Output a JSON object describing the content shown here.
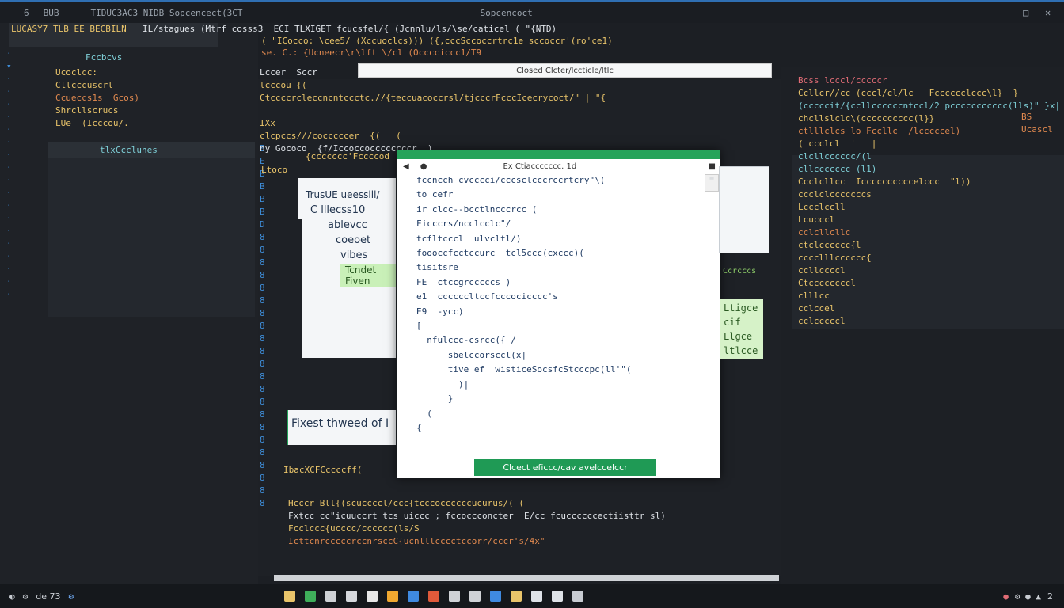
{
  "titlebar": {
    "left_a": "6",
    "left_b": "BUB",
    "path": "TIDUC3AC3 NIDB Sopcencect(3CT",
    "center": "Sopcencoct"
  },
  "toolbar": {
    "left": "LUCASY7 TLB EE BECBILN",
    "row1": "IL/stagues (Mtrf cosss3  ECI TLXIGET fcucsfel/{ (Jcnnlu/ls/\\se/caticel ( \"{NTD)",
    "row2": "( \"ICocco: \\cee5/ (Xccuoclcs))) ({,cccSccoccrtrc1e sccoccr'(ro'ce1)",
    "row3": "se. C.: {Ucneecr\\r\\lft \\/cl (Occcciccc1/T9",
    "subtab": "Fccbcvs"
  },
  "search": {
    "value": "Closed Clcter/lccticle/ltlc"
  },
  "left_panel": {
    "lines": [
      "Ucoclcc:",
      "Cllcccuscrl",
      "Ccueccs1s  Gcos)",
      "Shrcllscrucs",
      "LUe  (Icccou/.",
      "tlxCcclunes"
    ]
  },
  "center_code": {
    "l1": "Lccer  Sccr",
    "l2": "lcccou {(",
    "l3": "Ctccccrcleccncntccctc.//{teccuacoccrsl/tjcccrFcccIcecrycoct/\" | \"{",
    "l4": "IXx",
    "l5": "clcpccs///cocccccer  {(   (",
    "l6": "ny Gococo  {f/Iccoccoccccccccr  )",
    "l7": "{ccccccc'Fccccod",
    "l8": "Ltoco",
    "l9": "Hcccr Bll{(scuccccl/ccc{tcccoccccccucurus/( (",
    "l10": "Fxtcc cc\"icuuccrt tcs uiccc ; fccoccconcter  E/cc fcuccccccectiisttr sl)",
    "l11": "Fcclccc{ucccc/cccccc(ls/S",
    "l12": "IcttcnrcccccrccnrsccC{ucnlllcccctccorr/cccr's/4x\"",
    "l13": "IbacXCFCccccff(",
    "btn": "Ccrcccs"
  },
  "popup": {
    "line1": "TrusUE  ueesslll/",
    "line2": "C lllecss10",
    "line3": "ablevcc",
    "line4": "coeoet",
    "line5": "vibes",
    "chip1": "Tcndet",
    "chip2": "Fiven",
    "banner": "Fixest thweed of I"
  },
  "dialog": {
    "title": "Ex Ctiaccccccc. 1d",
    "lines": [
      "fccncch cvcccci/cccsclcccrccrtcry\"\\(",
      "to cefr",
      "ir clcc--bcctlncccrcc (",
      "Ficccrs/ncclcclc\"/",
      "tcfltcccl  ulvcltl/)",
      "foooccfcctccurc  tcl5ccc(cxccc)(",
      "tisitsre",
      "FE  ctccgrcccccs )",
      "e1  ccccccltccfcccocicccc's",
      "E9  -ycc)",
      "[",
      "  nfulccc-csrcc({ /",
      "      sbelccorsccl(x|",
      "      tive ef  wisticeSocsfcStcccpc(ll'\"(",
      "        )|",
      "      }",
      "  (",
      "{"
    ],
    "button": "Clcect eficcc/cav avelccelccr"
  },
  "right_panel": {
    "lines": [
      "Bcss lcccl/cccccr",
      "Ccllcr//cc (cccl/cl/lc   Fcccccclccc\\l}  }",
      "(cccccit/{ccllccccccntccl/2 pccccccccccc(lls)\" }x|",
      "chcllslclc\\(cccccccccc(l}}",
      "ctlllclcs lo Fccllc  /lcccccel)",
      "( ccclcl  '   |",
      "clcllcccccc/(l",
      "cllccccccc (l1)",
      "Ccclcllcc  Iccccccccccelccc  \"l))",
      "ccclclcccccccs",
      "Lccclccll",
      "Lcucccl",
      "cclcllcllc",
      "ctclcccccc{l",
      "cccclllcccccc{",
      "ccllccccl",
      "Ctccccccccl",
      "clllcc",
      "cclccel",
      "cclcccccl"
    ],
    "side1": "BS",
    "side2": "Ucascl",
    "chips": [
      "Ltigce",
      "cif",
      "Llgce",
      "ltlcce"
    ]
  },
  "taskbar": {
    "left": "de 73",
    "right": "2"
  }
}
